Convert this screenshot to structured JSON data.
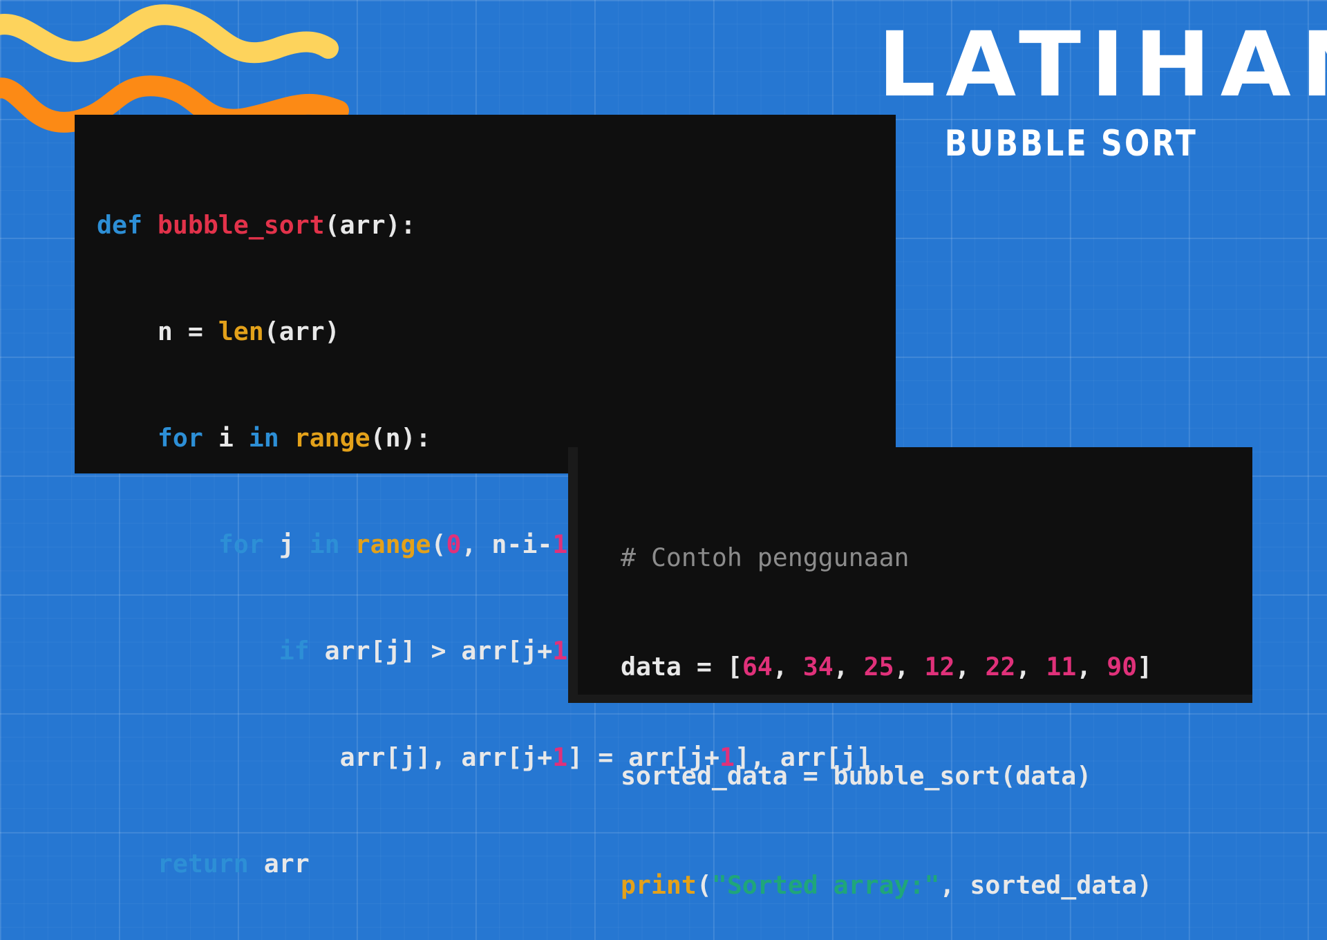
{
  "title": {
    "main": "LATIHAN",
    "sub": "BUBBLE SORT"
  },
  "colors": {
    "background": "#2677d2",
    "code_background": "#0f0f0f",
    "keyword": "#2d8fd6",
    "function_name": "#e2324a",
    "builtin": "#e3a11a",
    "number": "#e0317a",
    "string": "#1fa67a",
    "comment": "#8c8c8c",
    "squiggle_yellow": "#fdd35c",
    "squiggle_orange": "#fc8a15"
  },
  "code_main": {
    "l1": {
      "def": "def",
      "name": "bubble_sort",
      "rest": "(arr):"
    },
    "l2": {
      "a": "n = ",
      "len": "len",
      "b": "(arr)"
    },
    "l3": {
      "for": "for",
      "a": " i ",
      "in": "in",
      "b": " ",
      "range": "range",
      "c": "(n):"
    },
    "l4": {
      "for": "for",
      "a": " j ",
      "in": "in",
      "b": " ",
      "range": "range",
      "c": "(",
      "n0": "0",
      "d": ", n-i-",
      "n1": "1",
      "e": "):"
    },
    "l5": {
      "if": "if",
      "a": " arr[j] > arr[j+",
      "n1": "1",
      "b": "]:"
    },
    "l6": {
      "a": "arr[j], arr[j+",
      "n1": "1",
      "b": "] = arr[j+",
      "n2": "1",
      "c": "], arr[j]"
    },
    "l7": {
      "return": "return",
      "a": " arr"
    }
  },
  "code_usage": {
    "comment": "# Contoh penggunaan",
    "data_prefix": "data = [",
    "values": [
      "64",
      "34",
      "25",
      "12",
      "22",
      "11",
      "90"
    ],
    "sep": ", ",
    "data_suffix": "]",
    "sorted_line": "sorted_data = bubble_sort(data)",
    "print_fn": "print",
    "print_open": "(",
    "print_str": "\"Sorted array:\"",
    "print_rest": ", sorted_data)"
  }
}
